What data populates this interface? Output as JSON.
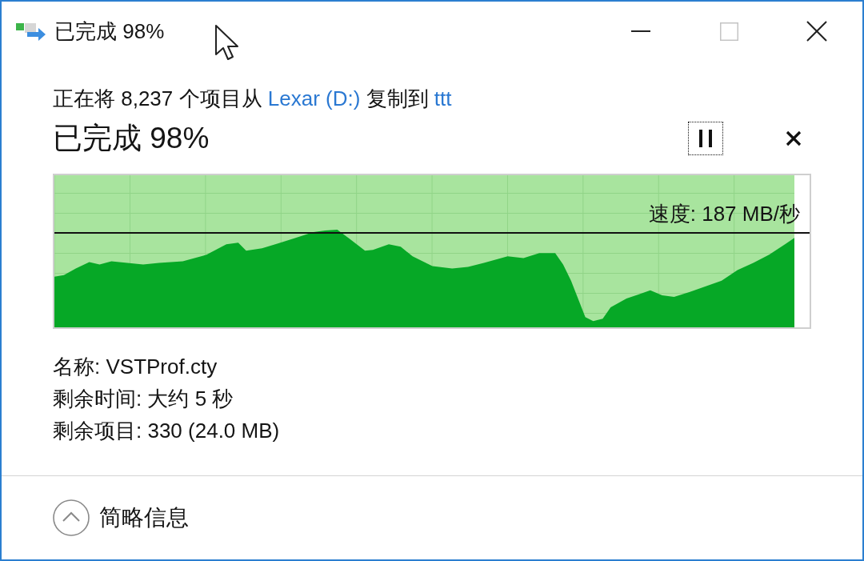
{
  "window": {
    "title": "已完成 98%",
    "buttons": [
      {
        "kind": "minimize",
        "disabled": false
      },
      {
        "kind": "maximize",
        "disabled": true
      },
      {
        "kind": "close",
        "disabled": false
      }
    ]
  },
  "description": [
    {
      "kind": "text",
      "text": "正在将 8,237 个项目从"
    },
    {
      "kind": "link",
      "text": "Lexar (D:)"
    },
    {
      "kind": "text",
      "text": "复制到"
    },
    {
      "kind": "link",
      "text": "ttt"
    }
  ],
  "progress": {
    "heading": "已完成 98%",
    "buttons": [
      {
        "kind": "pause",
        "focused": true
      },
      {
        "kind": "cancel",
        "focused": false
      }
    ],
    "level": 0.98,
    "speed_label": "速度: 187 MB/秒"
  },
  "details": [
    "名称: VSTProf.cty",
    "剩余时间: 大约 5 秒",
    "剩余项目: 330 (24.0 MB)"
  ],
  "footer": {
    "label": "简略信息",
    "expanded": true
  }
}
